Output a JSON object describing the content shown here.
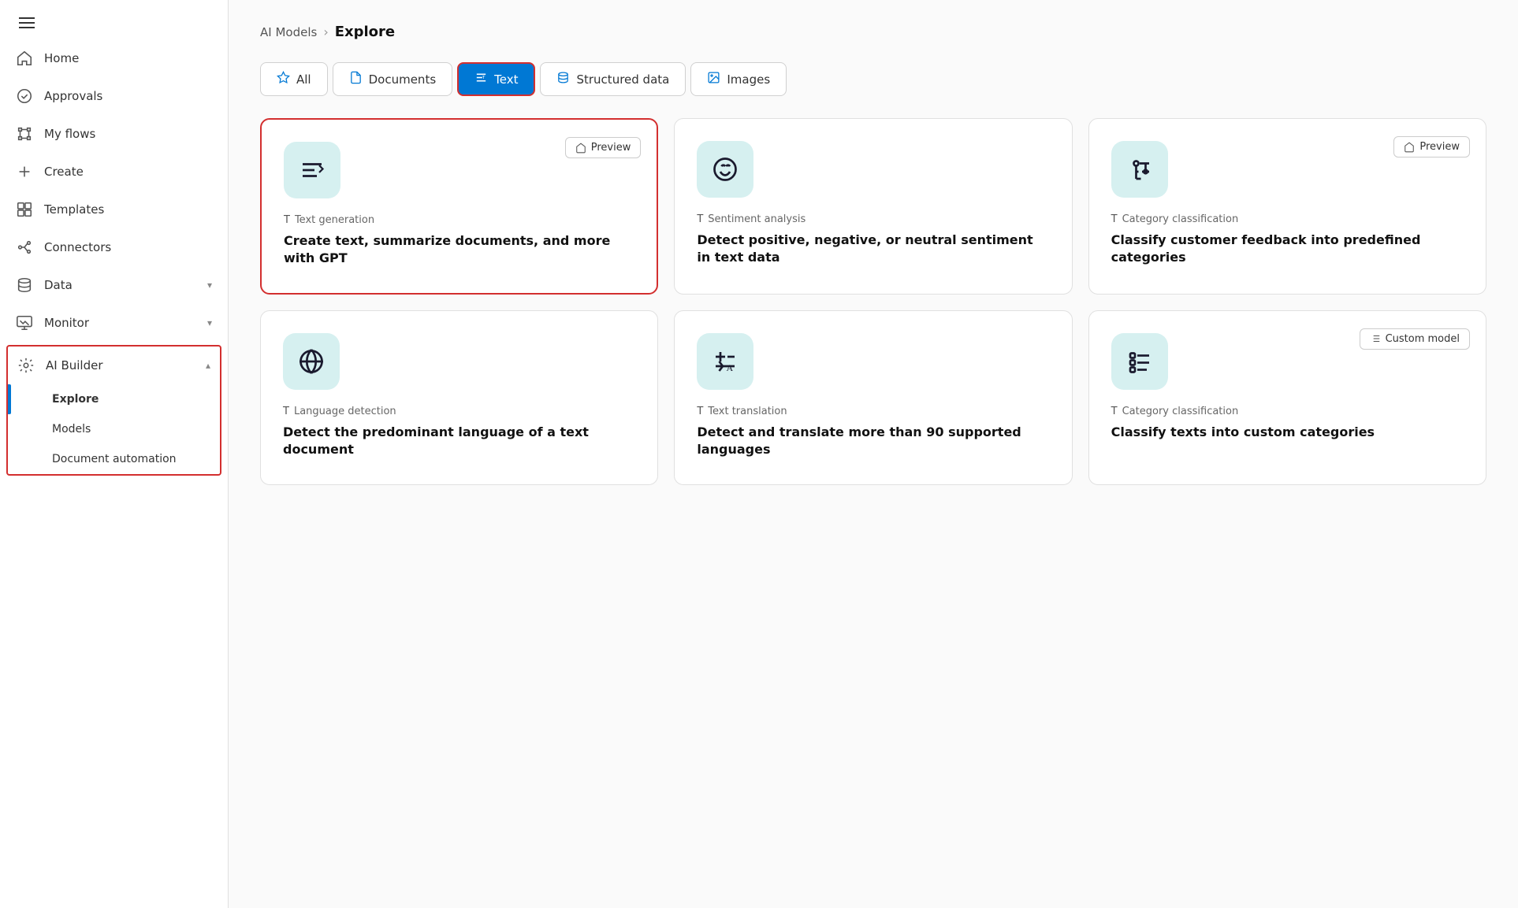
{
  "sidebar": {
    "items": [
      {
        "label": "Home",
        "icon": "home"
      },
      {
        "label": "Approvals",
        "icon": "approvals"
      },
      {
        "label": "My flows",
        "icon": "flows"
      },
      {
        "label": "Create",
        "icon": "create"
      },
      {
        "label": "Templates",
        "icon": "templates"
      },
      {
        "label": "Connectors",
        "icon": "connectors"
      },
      {
        "label": "Data",
        "icon": "data",
        "hasChevron": true
      },
      {
        "label": "Monitor",
        "icon": "monitor",
        "hasChevron": true
      },
      {
        "label": "AI Builder",
        "icon": "ai-builder",
        "hasChevron": true,
        "isAIBuilder": true
      },
      {
        "label": "Explore",
        "isSubItem": true,
        "active": true
      },
      {
        "label": "Models",
        "isSubItem": true
      },
      {
        "label": "Document automation",
        "isSubItem": true
      }
    ]
  },
  "breadcrumb": {
    "parent": "AI Models",
    "current": "Explore"
  },
  "tabs": [
    {
      "label": "All",
      "icon": "star",
      "active": false
    },
    {
      "label": "Documents",
      "icon": "document",
      "active": false
    },
    {
      "label": "Text",
      "icon": "text",
      "active": true
    },
    {
      "label": "Structured data",
      "icon": "database",
      "active": false
    },
    {
      "label": "Images",
      "icon": "image",
      "active": false
    }
  ],
  "cards": [
    {
      "id": "text-generation",
      "badge": "Preview",
      "type": "Text generation",
      "title": "Create text, summarize documents, and more with GPT",
      "highlighted": true
    },
    {
      "id": "sentiment-analysis",
      "badge": null,
      "type": "Sentiment analysis",
      "title": "Detect positive, negative, or neutral sentiment in text data",
      "highlighted": false
    },
    {
      "id": "category-classification-1",
      "badge": "Preview",
      "type": "Category classification",
      "title": "Classify customer feedback into predefined categories",
      "highlighted": false
    },
    {
      "id": "language-detection",
      "badge": null,
      "type": "Language detection",
      "title": "Detect the predominant language of a text document",
      "highlighted": false
    },
    {
      "id": "text-translation",
      "badge": null,
      "type": "Text translation",
      "title": "Detect and translate more than 90 supported languages",
      "highlighted": false
    },
    {
      "id": "category-classification-2",
      "badge": "Custom model",
      "type": "Category classification",
      "title": "Classify texts into custom categories",
      "highlighted": false
    }
  ],
  "icons": {
    "preview_label": "Preview",
    "custom_model_label": "Custom model"
  }
}
